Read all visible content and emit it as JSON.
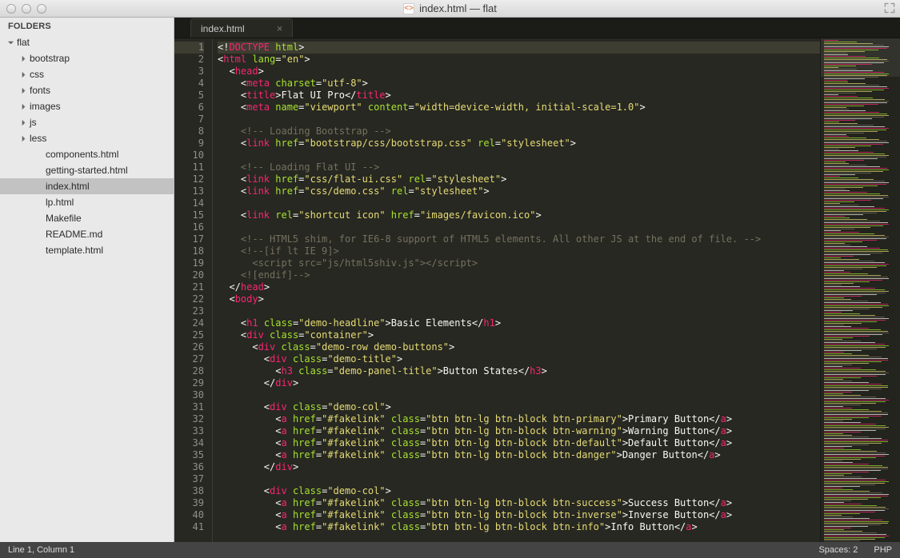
{
  "window": {
    "title": "index.html — flat",
    "icon_glyph": "<>"
  },
  "sidebar": {
    "header": "FOLDERS",
    "root": "flat",
    "folders": [
      "bootstrap",
      "css",
      "fonts",
      "images",
      "js",
      "less"
    ],
    "files": [
      "components.html",
      "getting-started.html",
      "index.html",
      "lp.html",
      "Makefile",
      "README.md",
      "template.html"
    ],
    "selected_file": "index.html"
  },
  "tab": {
    "name": "index.html",
    "close_glyph": "×"
  },
  "editor": {
    "first_line": 1,
    "last_line": 41,
    "lines": [
      [
        [
          "s-white",
          "<!"
        ],
        [
          "s-pink",
          "DOCTYPE"
        ],
        [
          "s-white",
          " "
        ],
        [
          "s-green",
          "html"
        ],
        [
          "s-white",
          ">"
        ]
      ],
      [
        [
          "s-white",
          "<"
        ],
        [
          "s-pink",
          "html"
        ],
        [
          "s-white",
          " "
        ],
        [
          "s-green",
          "lang"
        ],
        [
          "s-white",
          "="
        ],
        [
          "s-yellow",
          "\"en\""
        ],
        [
          "s-white",
          ">"
        ]
      ],
      [
        [
          "s-white",
          "  <"
        ],
        [
          "s-pink",
          "head"
        ],
        [
          "s-white",
          ">"
        ]
      ],
      [
        [
          "s-white",
          "    <"
        ],
        [
          "s-pink",
          "meta"
        ],
        [
          "s-white",
          " "
        ],
        [
          "s-green",
          "charset"
        ],
        [
          "s-white",
          "="
        ],
        [
          "s-yellow",
          "\"utf-8\""
        ],
        [
          "s-white",
          ">"
        ]
      ],
      [
        [
          "s-white",
          "    <"
        ],
        [
          "s-pink",
          "title"
        ],
        [
          "s-white",
          ">Flat UI Pro</"
        ],
        [
          "s-pink",
          "title"
        ],
        [
          "s-white",
          ">"
        ]
      ],
      [
        [
          "s-white",
          "    <"
        ],
        [
          "s-pink",
          "meta"
        ],
        [
          "s-white",
          " "
        ],
        [
          "s-green",
          "name"
        ],
        [
          "s-white",
          "="
        ],
        [
          "s-yellow",
          "\"viewport\""
        ],
        [
          "s-white",
          " "
        ],
        [
          "s-green",
          "content"
        ],
        [
          "s-white",
          "="
        ],
        [
          "s-yellow",
          "\"width=device-width, initial-scale=1.0\""
        ],
        [
          "s-white",
          ">"
        ]
      ],
      [
        [
          "s-white",
          ""
        ]
      ],
      [
        [
          "s-white",
          "    "
        ],
        [
          "s-grey",
          "<!-- Loading Bootstrap -->"
        ]
      ],
      [
        [
          "s-white",
          "    <"
        ],
        [
          "s-pink",
          "link"
        ],
        [
          "s-white",
          " "
        ],
        [
          "s-green",
          "href"
        ],
        [
          "s-white",
          "="
        ],
        [
          "s-yellow",
          "\"bootstrap/css/bootstrap.css\""
        ],
        [
          "s-white",
          " "
        ],
        [
          "s-green",
          "rel"
        ],
        [
          "s-white",
          "="
        ],
        [
          "s-yellow",
          "\"stylesheet\""
        ],
        [
          "s-white",
          ">"
        ]
      ],
      [
        [
          "s-white",
          ""
        ]
      ],
      [
        [
          "s-white",
          "    "
        ],
        [
          "s-grey",
          "<!-- Loading Flat UI -->"
        ]
      ],
      [
        [
          "s-white",
          "    <"
        ],
        [
          "s-pink",
          "link"
        ],
        [
          "s-white",
          " "
        ],
        [
          "s-green",
          "href"
        ],
        [
          "s-white",
          "="
        ],
        [
          "s-yellow",
          "\"css/flat-ui.css\""
        ],
        [
          "s-white",
          " "
        ],
        [
          "s-green",
          "rel"
        ],
        [
          "s-white",
          "="
        ],
        [
          "s-yellow",
          "\"stylesheet\""
        ],
        [
          "s-white",
          ">"
        ]
      ],
      [
        [
          "s-white",
          "    <"
        ],
        [
          "s-pink",
          "link"
        ],
        [
          "s-white",
          " "
        ],
        [
          "s-green",
          "href"
        ],
        [
          "s-white",
          "="
        ],
        [
          "s-yellow",
          "\"css/demo.css\""
        ],
        [
          "s-white",
          " "
        ],
        [
          "s-green",
          "rel"
        ],
        [
          "s-white",
          "="
        ],
        [
          "s-yellow",
          "\"stylesheet\""
        ],
        [
          "s-white",
          ">"
        ]
      ],
      [
        [
          "s-white",
          ""
        ]
      ],
      [
        [
          "s-white",
          "    <"
        ],
        [
          "s-pink",
          "link"
        ],
        [
          "s-white",
          " "
        ],
        [
          "s-green",
          "rel"
        ],
        [
          "s-white",
          "="
        ],
        [
          "s-yellow",
          "\"shortcut icon\""
        ],
        [
          "s-white",
          " "
        ],
        [
          "s-green",
          "href"
        ],
        [
          "s-white",
          "="
        ],
        [
          "s-yellow",
          "\"images/favicon.ico\""
        ],
        [
          "s-white",
          ">"
        ]
      ],
      [
        [
          "s-white",
          ""
        ]
      ],
      [
        [
          "s-white",
          "    "
        ],
        [
          "s-grey",
          "<!-- HTML5 shim, for IE6-8 support of HTML5 elements. All other JS at the end of file. -->"
        ]
      ],
      [
        [
          "s-white",
          "    "
        ],
        [
          "s-grey",
          "<!--[if lt IE 9]>"
        ]
      ],
      [
        [
          "s-white",
          "      "
        ],
        [
          "s-grey",
          "<script src=\"js/html5shiv.js\"></script>"
        ]
      ],
      [
        [
          "s-white",
          "    "
        ],
        [
          "s-grey",
          "<![endif]-->"
        ]
      ],
      [
        [
          "s-white",
          "  </"
        ],
        [
          "s-pink",
          "head"
        ],
        [
          "s-white",
          ">"
        ]
      ],
      [
        [
          "s-white",
          "  <"
        ],
        [
          "s-pink",
          "body"
        ],
        [
          "s-white",
          ">"
        ]
      ],
      [
        [
          "s-white",
          ""
        ]
      ],
      [
        [
          "s-white",
          "    <"
        ],
        [
          "s-pink",
          "h1"
        ],
        [
          "s-white",
          " "
        ],
        [
          "s-green",
          "class"
        ],
        [
          "s-white",
          "="
        ],
        [
          "s-yellow",
          "\"demo-headline\""
        ],
        [
          "s-white",
          ">Basic Elements</"
        ],
        [
          "s-pink",
          "h1"
        ],
        [
          "s-white",
          ">"
        ]
      ],
      [
        [
          "s-white",
          "    <"
        ],
        [
          "s-pink",
          "div"
        ],
        [
          "s-white",
          " "
        ],
        [
          "s-green",
          "class"
        ],
        [
          "s-white",
          "="
        ],
        [
          "s-yellow",
          "\"container\""
        ],
        [
          "s-white",
          ">"
        ]
      ],
      [
        [
          "s-white",
          "      <"
        ],
        [
          "s-pink",
          "div"
        ],
        [
          "s-white",
          " "
        ],
        [
          "s-green",
          "class"
        ],
        [
          "s-white",
          "="
        ],
        [
          "s-yellow",
          "\"demo-row demo-buttons\""
        ],
        [
          "s-white",
          ">"
        ]
      ],
      [
        [
          "s-white",
          "        <"
        ],
        [
          "s-pink",
          "div"
        ],
        [
          "s-white",
          " "
        ],
        [
          "s-green",
          "class"
        ],
        [
          "s-white",
          "="
        ],
        [
          "s-yellow",
          "\"demo-title\""
        ],
        [
          "s-white",
          ">"
        ]
      ],
      [
        [
          "s-white",
          "          <"
        ],
        [
          "s-pink",
          "h3"
        ],
        [
          "s-white",
          " "
        ],
        [
          "s-green",
          "class"
        ],
        [
          "s-white",
          "="
        ],
        [
          "s-yellow",
          "\"demo-panel-title\""
        ],
        [
          "s-white",
          ">Button States</"
        ],
        [
          "s-pink",
          "h3"
        ],
        [
          "s-white",
          ">"
        ]
      ],
      [
        [
          "s-white",
          "        </"
        ],
        [
          "s-pink",
          "div"
        ],
        [
          "s-white",
          ">"
        ]
      ],
      [
        [
          "s-white",
          ""
        ]
      ],
      [
        [
          "s-white",
          "        <"
        ],
        [
          "s-pink",
          "div"
        ],
        [
          "s-white",
          " "
        ],
        [
          "s-green",
          "class"
        ],
        [
          "s-white",
          "="
        ],
        [
          "s-yellow",
          "\"demo-col\""
        ],
        [
          "s-white",
          ">"
        ]
      ],
      [
        [
          "s-white",
          "          <"
        ],
        [
          "s-pink",
          "a"
        ],
        [
          "s-white",
          " "
        ],
        [
          "s-green",
          "href"
        ],
        [
          "s-white",
          "="
        ],
        [
          "s-yellow",
          "\"#fakelink\""
        ],
        [
          "s-white",
          " "
        ],
        [
          "s-green",
          "class"
        ],
        [
          "s-white",
          "="
        ],
        [
          "s-yellow",
          "\"btn btn-lg btn-block btn-primary\""
        ],
        [
          "s-white",
          ">Primary Button</"
        ],
        [
          "s-pink",
          "a"
        ],
        [
          "s-white",
          ">"
        ]
      ],
      [
        [
          "s-white",
          "          <"
        ],
        [
          "s-pink",
          "a"
        ],
        [
          "s-white",
          " "
        ],
        [
          "s-green",
          "href"
        ],
        [
          "s-white",
          "="
        ],
        [
          "s-yellow",
          "\"#fakelink\""
        ],
        [
          "s-white",
          " "
        ],
        [
          "s-green",
          "class"
        ],
        [
          "s-white",
          "="
        ],
        [
          "s-yellow",
          "\"btn btn-lg btn-block btn-warning\""
        ],
        [
          "s-white",
          ">Warning Button</"
        ],
        [
          "s-pink",
          "a"
        ],
        [
          "s-white",
          ">"
        ]
      ],
      [
        [
          "s-white",
          "          <"
        ],
        [
          "s-pink",
          "a"
        ],
        [
          "s-white",
          " "
        ],
        [
          "s-green",
          "href"
        ],
        [
          "s-white",
          "="
        ],
        [
          "s-yellow",
          "\"#fakelink\""
        ],
        [
          "s-white",
          " "
        ],
        [
          "s-green",
          "class"
        ],
        [
          "s-white",
          "="
        ],
        [
          "s-yellow",
          "\"btn btn-lg btn-block btn-default\""
        ],
        [
          "s-white",
          ">Default Button</"
        ],
        [
          "s-pink",
          "a"
        ],
        [
          "s-white",
          ">"
        ]
      ],
      [
        [
          "s-white",
          "          <"
        ],
        [
          "s-pink",
          "a"
        ],
        [
          "s-white",
          " "
        ],
        [
          "s-green",
          "href"
        ],
        [
          "s-white",
          "="
        ],
        [
          "s-yellow",
          "\"#fakelink\""
        ],
        [
          "s-white",
          " "
        ],
        [
          "s-green",
          "class"
        ],
        [
          "s-white",
          "="
        ],
        [
          "s-yellow",
          "\"btn btn-lg btn-block btn-danger\""
        ],
        [
          "s-white",
          ">Danger Button</"
        ],
        [
          "s-pink",
          "a"
        ],
        [
          "s-white",
          ">"
        ]
      ],
      [
        [
          "s-white",
          "        </"
        ],
        [
          "s-pink",
          "div"
        ],
        [
          "s-white",
          ">"
        ]
      ],
      [
        [
          "s-white",
          ""
        ]
      ],
      [
        [
          "s-white",
          "        <"
        ],
        [
          "s-pink",
          "div"
        ],
        [
          "s-white",
          " "
        ],
        [
          "s-green",
          "class"
        ],
        [
          "s-white",
          "="
        ],
        [
          "s-yellow",
          "\"demo-col\""
        ],
        [
          "s-white",
          ">"
        ]
      ],
      [
        [
          "s-white",
          "          <"
        ],
        [
          "s-pink",
          "a"
        ],
        [
          "s-white",
          " "
        ],
        [
          "s-green",
          "href"
        ],
        [
          "s-white",
          "="
        ],
        [
          "s-yellow",
          "\"#fakelink\""
        ],
        [
          "s-white",
          " "
        ],
        [
          "s-green",
          "class"
        ],
        [
          "s-white",
          "="
        ],
        [
          "s-yellow",
          "\"btn btn-lg btn-block btn-success\""
        ],
        [
          "s-white",
          ">Success Button</"
        ],
        [
          "s-pink",
          "a"
        ],
        [
          "s-white",
          ">"
        ]
      ],
      [
        [
          "s-white",
          "          <"
        ],
        [
          "s-pink",
          "a"
        ],
        [
          "s-white",
          " "
        ],
        [
          "s-green",
          "href"
        ],
        [
          "s-white",
          "="
        ],
        [
          "s-yellow",
          "\"#fakelink\""
        ],
        [
          "s-white",
          " "
        ],
        [
          "s-green",
          "class"
        ],
        [
          "s-white",
          "="
        ],
        [
          "s-yellow",
          "\"btn btn-lg btn-block btn-inverse\""
        ],
        [
          "s-white",
          ">Inverse Button</"
        ],
        [
          "s-pink",
          "a"
        ],
        [
          "s-white",
          ">"
        ]
      ],
      [
        [
          "s-white",
          "          <"
        ],
        [
          "s-pink",
          "a"
        ],
        [
          "s-white",
          " "
        ],
        [
          "s-green",
          "href"
        ],
        [
          "s-white",
          "="
        ],
        [
          "s-yellow",
          "\"#fakelink\""
        ],
        [
          "s-white",
          " "
        ],
        [
          "s-green",
          "class"
        ],
        [
          "s-white",
          "="
        ],
        [
          "s-yellow",
          "\"btn btn-lg btn-block btn-info\""
        ],
        [
          "s-white",
          ">Info Button</"
        ],
        [
          "s-pink",
          "a"
        ],
        [
          "s-white",
          ">"
        ]
      ]
    ]
  },
  "status": {
    "left": "Line 1, Column 1",
    "spaces": "Spaces: 2",
    "lang": "PHP"
  },
  "colors": {
    "minimap_palette": [
      "#f92672",
      "#a6e22e",
      "#e6db74",
      "#75715e",
      "#f8f8f2"
    ]
  }
}
